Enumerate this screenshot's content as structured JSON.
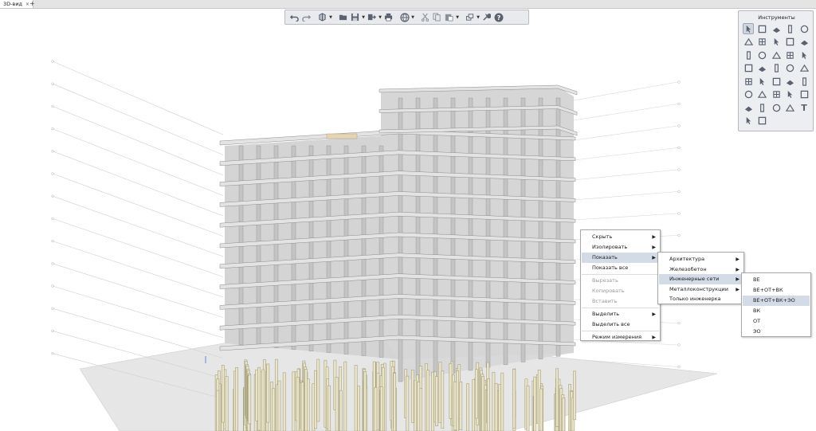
{
  "tab": {
    "label": "3D-вид",
    "close": "×",
    "add": "+"
  },
  "toolbar": {
    "buttons": [
      "undo-icon",
      "redo-icon",
      "views-icon",
      "folder-icon",
      "save-icon",
      "export-icon",
      "print-icon",
      "globe-icon",
      "cut-icon",
      "copy-icon",
      "paste-icon",
      "layers-icon",
      "wrench-icon",
      "help-icon"
    ]
  },
  "tools_panel": {
    "title": "Инструменты",
    "grid": [
      [
        "cursor-icon",
        "node-select-icon",
        "rectangle-icon",
        "column-icon",
        "pencil-icon"
      ],
      [
        "slab-icon",
        "sloped-slab-icon",
        "roof-icon",
        "stair-icon",
        "beam-icon"
      ],
      [
        "door-icon",
        "window-icon",
        "wall-icon",
        "opening-icon",
        "object-icon"
      ],
      [
        "arc-icon",
        "room-icon",
        "line-icon",
        "dimension-icon",
        "grid-axis-icon"
      ],
      [
        "pipe-icon",
        "duct-icon",
        "fitting-icon",
        "valve-icon",
        "equipment-icon"
      ],
      [
        "terminal-icon",
        "tray-icon",
        "cable-icon",
        "elbow-icon",
        "mark-icon"
      ],
      [
        "house-icon",
        "cabinet-icon",
        "section-icon",
        "measure-icon",
        "text-icon"
      ],
      [
        "tools-icon",
        "rotate-icon"
      ]
    ],
    "text_tool": "T"
  },
  "context_menu": {
    "items": [
      {
        "label": "Скрыть",
        "submenu": true
      },
      {
        "label": "Изолировать",
        "submenu": true
      },
      {
        "label": "Показать",
        "submenu": true,
        "highlight": true
      },
      {
        "label": "Показать все"
      },
      {
        "label": "Вырезать",
        "disabled": true
      },
      {
        "label": "Копировать",
        "disabled": true
      },
      {
        "label": "Вставить",
        "disabled": true
      },
      {
        "label": "Выделить",
        "submenu": true
      },
      {
        "label": "Выделить все"
      },
      {
        "label": "Режим измерения",
        "submenu": true
      }
    ],
    "arrow": "▶"
  },
  "submenu_show": {
    "items": [
      {
        "label": "Архитектура",
        "submenu": true
      },
      {
        "label": "Железобетон",
        "submenu": true
      },
      {
        "label": "Инженерные сети",
        "submenu": true,
        "highlight": true
      },
      {
        "label": "Металлоконструкции",
        "submenu": true
      },
      {
        "label": "Только инженерка"
      }
    ]
  },
  "submenu_eng": {
    "items": [
      {
        "label": "ВЕ"
      },
      {
        "label": "ВЕ+ОТ+ВК"
      },
      {
        "label": "ВЕ+ОТ+ВК+ЭО",
        "highlight": true
      },
      {
        "label": "ВК"
      },
      {
        "label": "ОТ"
      },
      {
        "label": "ЭО"
      }
    ]
  },
  "colors": {
    "slab": "#e3e3e3",
    "slab_edge": "#8c8c8c",
    "pile": "#e9e4c9",
    "pile_edge": "#9b9572",
    "menu_highlight": "#d3dbe6"
  }
}
